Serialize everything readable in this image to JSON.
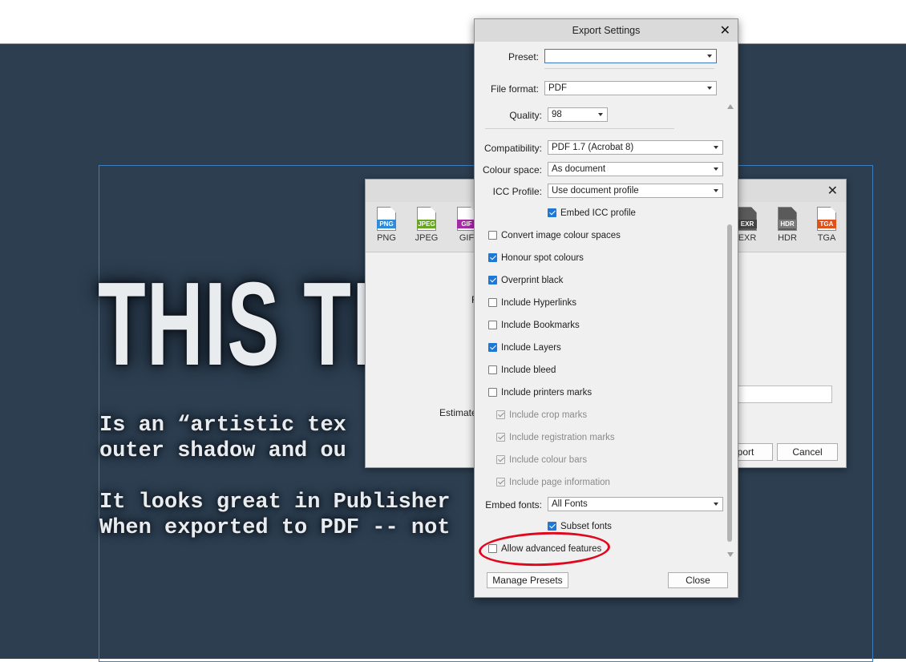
{
  "canvas": {
    "headline": "THIS TI",
    "lines": [
      "Is an “artistic tex",
      "outer shadow and ou",
      "It looks great in Publisher",
      "When exported to PDF -- not"
    ]
  },
  "background_dialog": {
    "close_icon": "✕",
    "formats_left": [
      "PNG",
      "JPEG",
      "GIF"
    ],
    "formats_right": [
      "EXR",
      "HDR",
      "TGA"
    ],
    "badge_colors": {
      "PNG": "#2f8ad8",
      "JPEG": "#6aa52a",
      "GIF": "#a52aa5",
      "EXR": "#444444",
      "HDR": "#7a7a7a",
      "TGA": "#e0521b"
    },
    "partial_label_r": "R",
    "estimated_label": "Estimated",
    "export_button": "port",
    "cancel_button": "Cancel"
  },
  "export_settings": {
    "title": "Export Settings",
    "close_icon": "✕",
    "preset_label": "Preset:",
    "preset_value": "",
    "file_format_label": "File format:",
    "file_format_value": "PDF",
    "quality_label": "Quality:",
    "quality_value": "98",
    "compatibility_label": "Compatibility:",
    "compatibility_value": "PDF 1.7 (Acrobat 8)",
    "colour_space_label": "Colour space:",
    "colour_space_value": "As document",
    "icc_profile_label": "ICC Profile:",
    "icc_profile_value": "Use document profile",
    "embed_icc_label": "Embed ICC profile",
    "options": [
      {
        "label": "Convert image colour spaces",
        "checked": false,
        "disabled": false
      },
      {
        "label": "Honour spot colours",
        "checked": true,
        "disabled": false
      },
      {
        "label": "Overprint black",
        "checked": true,
        "disabled": false
      },
      {
        "label": "Include Hyperlinks",
        "checked": false,
        "disabled": false
      },
      {
        "label": "Include Bookmarks",
        "checked": false,
        "disabled": false
      },
      {
        "label": "Include Layers",
        "checked": true,
        "disabled": false
      },
      {
        "label": "Include bleed",
        "checked": false,
        "disabled": false
      },
      {
        "label": "Include printers marks",
        "checked": false,
        "disabled": false
      },
      {
        "label": "Include crop marks",
        "checked": true,
        "disabled": true
      },
      {
        "label": "Include registration marks",
        "checked": true,
        "disabled": true
      },
      {
        "label": "Include colour bars",
        "checked": true,
        "disabled": true
      },
      {
        "label": "Include page information",
        "checked": true,
        "disabled": true
      }
    ],
    "embed_fonts_label": "Embed fonts:",
    "embed_fonts_value": "All Fonts",
    "subset_fonts_label": "Subset fonts",
    "advanced_label": "Allow advanced features",
    "manage_presets_button": "Manage Presets",
    "close_button": "Close"
  },
  "colors": {
    "canvas_bg": "#2c3e50",
    "checkbox_accent": "#1f77d6",
    "annotation_circle": "#e0081e"
  }
}
